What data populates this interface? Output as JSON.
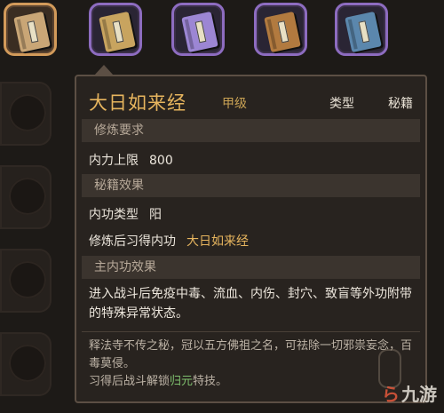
{
  "books": [
    {
      "name": "book-slot-1",
      "color": "#c9a676",
      "selected": true
    },
    {
      "name": "book-slot-2",
      "color": "#c8a45f",
      "selected": false
    },
    {
      "name": "book-slot-3",
      "color": "#9c86d4",
      "selected": false
    },
    {
      "name": "book-slot-4",
      "color": "#b27a3f",
      "selected": false
    },
    {
      "name": "book-slot-5",
      "color": "#5b87ad",
      "selected": false
    }
  ],
  "tooltip": {
    "title": "大日如来经",
    "grade": "甲级",
    "type_label": "类型",
    "type_value": "秘籍",
    "sections": {
      "requirements": "修炼要求",
      "book_effect": "秘籍效果",
      "main_effect": "主内功效果"
    },
    "requirement_label": "内力上限",
    "requirement_value": "800",
    "internal_type_label": "内功类型",
    "internal_type_value": "阳",
    "learn_label": "修炼后习得内功",
    "learn_value": "大日如来经",
    "main_effect_text": "进入战斗后免疫中毒、流血、内伤、封穴、致盲等外功附带的特殊异常状态。",
    "lore_text": "释法寺不传之秘，冠以五方佛祖之名，可祛除一切邪祟妄念，百毒莫侵。",
    "lore_line2_prefix": "习得后战斗解锁",
    "lore_line2_highlight": "归元",
    "lore_line2_suffix": "特技。"
  },
  "watermark": {
    "mark": "ら",
    "text": "九游"
  }
}
